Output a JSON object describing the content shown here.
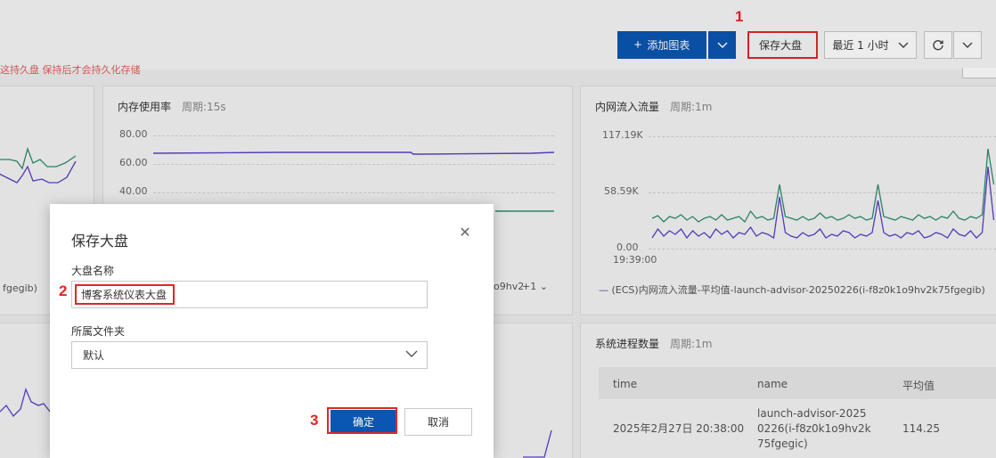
{
  "toolbar": {
    "add_chart_label": "添加图表",
    "save_dashboard_label": "保存大盘",
    "time_range_label": "最近 1 小时",
    "warning_text": "这持久盘 保持后才会持久化存储"
  },
  "annotations": {
    "step1": "1",
    "step2": "2",
    "step3": "3"
  },
  "panels": {
    "memory": {
      "title": "内存使用率",
      "period": "周期:15s",
      "ticks": [
        "80.00",
        "60.00",
        "40.00"
      ]
    },
    "net_in": {
      "title": "内网流入流量",
      "period": "周期:1m",
      "ticks": [
        "117.19K",
        "58.59K",
        "0.00"
      ],
      "x_label": "19:39:00",
      "legend": "(ECS)内网流入流量-平均值-launch-advisor-20250226(i-f8z0k1o9hv2k75fgegib)"
    },
    "left_legend_fragment": "fgegib)",
    "mid_legend_fragment": "o9hv2",
    "mid_legend_more": "+1",
    "process": {
      "title": "系统进程数量",
      "period": "周期:1m",
      "columns": [
        "time",
        "name",
        "平均值"
      ],
      "rows": [
        {
          "time": "2025年2月27日 20:38:00",
          "name": "launch-advisor-20250226(i-f8z0k1o9hv2k75fgegic)",
          "value": "114.25"
        }
      ]
    }
  },
  "dialog": {
    "title": "保存大盘",
    "name_label": "大盘名称",
    "name_value": "博客系统仪表大盘",
    "folder_label": "所属文件夹",
    "folder_value": "默认",
    "ok_label": "确定",
    "cancel_label": "取消"
  },
  "colors": {
    "primary": "#0a56b0",
    "highlight": "#e0262a",
    "series_purple": "#5b3fc4",
    "series_green": "#2e8b6f"
  }
}
